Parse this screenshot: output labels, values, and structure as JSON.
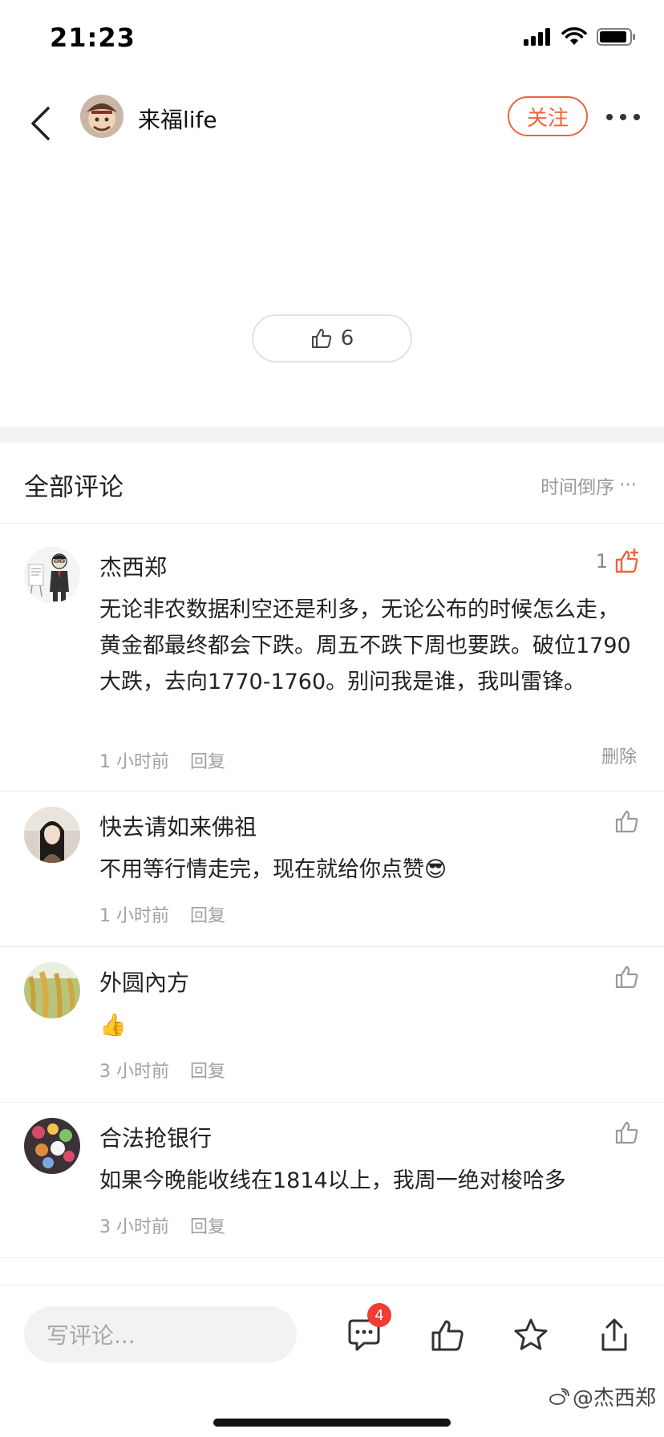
{
  "status_bar": {
    "time": "21:23"
  },
  "header": {
    "author_name": "来福life",
    "follow_label": "关注"
  },
  "post": {
    "like_count": "6"
  },
  "comments_section": {
    "title": "全部评论",
    "sort_label": "时间倒序",
    "sort_more": "···"
  },
  "comments": [
    {
      "name": "杰西郑",
      "text": "无论非农数据利空还是利多，无论公布的时候怎么走，黄金都最终都会下跌。周五不跌下周也要跌。破位1790大跌，去向1770-1760。别问我是谁，我叫雷锋。",
      "time": "1 小时前",
      "reply_label": "回复",
      "likes": "1",
      "delete_label": "删除"
    },
    {
      "name": "快去请如来佛祖",
      "text": "不用等行情走完，现在就给你点赞😎",
      "time": "1 小时前",
      "reply_label": "回复"
    },
    {
      "name": "外圆內方",
      "text": "👍",
      "time": "3 小时前",
      "reply_label": "回复"
    },
    {
      "name": "合法抢银行",
      "text": "如果今晚能收线在1814以上，我周一绝对梭哈多",
      "time": "3 小时前",
      "reply_label": "回复"
    }
  ],
  "bottom_bar": {
    "input_placeholder": "写评论...",
    "comment_badge": "4",
    "watermark": "@杰西郑"
  },
  "colors": {
    "accent": "#f0643c",
    "badge": "#f03c32"
  }
}
